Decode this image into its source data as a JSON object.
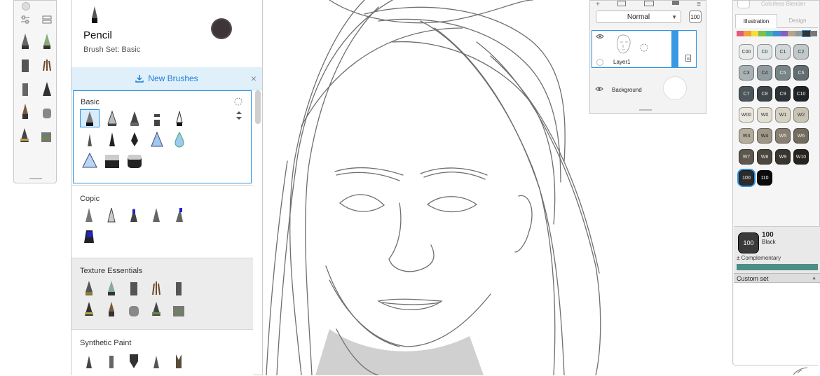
{
  "brush_header": {
    "name": "Pencil",
    "set": "Brush Set: Basic"
  },
  "new_brushes": {
    "label": "New Brushes",
    "close": "×"
  },
  "brush_sets": [
    {
      "title": "Basic"
    },
    {
      "title": "Copic"
    },
    {
      "title": "Texture Essentials"
    },
    {
      "title": "Synthetic Paint"
    }
  ],
  "layers": {
    "blend_mode": "Normal",
    "opacity": "100",
    "layer1_name": "Layer1",
    "background_name": "Background"
  },
  "copic": {
    "header": "Colorless Blender",
    "tabs": [
      "Illustration",
      "Design"
    ],
    "active_tab": "Illustration",
    "swatches": [
      {
        "code": "C00",
        "color": "#e7ebea",
        "text": "#333"
      },
      {
        "code": "C0",
        "color": "#dfe4e4",
        "text": "#333"
      },
      {
        "code": "C1",
        "color": "#d1d7d8",
        "text": "#333"
      },
      {
        "code": "C2",
        "color": "#c0c8ca",
        "text": "#333"
      },
      {
        "code": "C3",
        "color": "#a9b3b6",
        "text": "#222"
      },
      {
        "code": "C4",
        "color": "#919ca0",
        "text": "#222"
      },
      {
        "code": "C5",
        "color": "#788488",
        "text": "#eee"
      },
      {
        "code": "C6",
        "color": "#626d71",
        "text": "#eee"
      },
      {
        "code": "C7",
        "color": "#4d575b",
        "text": "#eee"
      },
      {
        "code": "C8",
        "color": "#3d4548",
        "text": "#eee"
      },
      {
        "code": "C9",
        "color": "#2d3335",
        "text": "#eee"
      },
      {
        "code": "C10",
        "color": "#1f2325",
        "text": "#eee"
      },
      {
        "code": "W00",
        "color": "#eae7de",
        "text": "#333"
      },
      {
        "code": "W0",
        "color": "#e3dfd3",
        "text": "#333"
      },
      {
        "code": "W1",
        "color": "#d6d1c3",
        "text": "#333"
      },
      {
        "code": "W2",
        "color": "#c9c3b3",
        "text": "#333"
      },
      {
        "code": "W3",
        "color": "#b4ad9c",
        "text": "#222"
      },
      {
        "code": "W4",
        "color": "#9e9686",
        "text": "#222"
      },
      {
        "code": "W5",
        "color": "#878072",
        "text": "#eee"
      },
      {
        "code": "W6",
        "color": "#726b5f",
        "text": "#eee"
      },
      {
        "code": "W7",
        "color": "#5d574d",
        "text": "#eee"
      },
      {
        "code": "W8",
        "color": "#4b463e",
        "text": "#eee"
      },
      {
        "code": "W9",
        "color": "#38342e",
        "text": "#eee"
      },
      {
        "code": "W10",
        "color": "#272420",
        "text": "#eee"
      },
      {
        "code": "100",
        "color": "#2b2b2b",
        "text": "#fff",
        "selected": true
      },
      {
        "code": "110",
        "color": "#0b0b0b",
        "text": "#fff"
      }
    ],
    "current_code": "100",
    "current_name": "Black",
    "complementary_label": "± Complementary",
    "complementary_color": "#4d8f84",
    "custom_set_label": "Custom set"
  }
}
